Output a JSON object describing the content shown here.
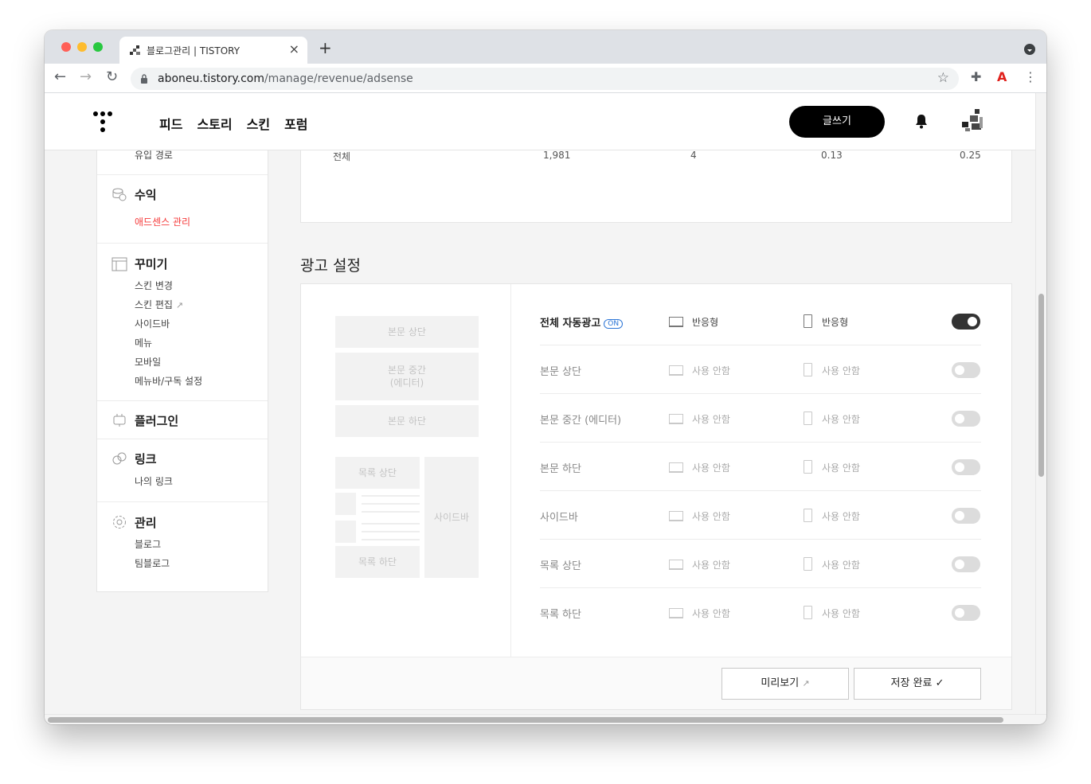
{
  "browser": {
    "tab_title": "블로그관리 | TISTORY",
    "tab_close": "×",
    "new_tab": "+",
    "url_domain": "aboneu.tistory.com",
    "url_path": "/manage/revenue/adsense"
  },
  "header": {
    "nav": [
      "피드",
      "스토리",
      "스킨",
      "포럼"
    ],
    "write_label": "글쓰기"
  },
  "sidebar": {
    "inflow_item": "유입 경로",
    "revenue": {
      "title": "수익",
      "items": [
        "애드센스 관리"
      ]
    },
    "decorate": {
      "title": "꾸미기",
      "items": [
        "스킨 변경",
        "스킨 편집",
        "사이드바",
        "메뉴",
        "모바일",
        "메뉴바/구독 설정"
      ]
    },
    "plugin": {
      "title": "플러그인"
    },
    "link": {
      "title": "링크",
      "items": [
        "나의 링크"
      ]
    },
    "manage": {
      "title": "관리",
      "items": [
        "블로그",
        "팀블로그"
      ]
    }
  },
  "stats_total": {
    "label": "전체",
    "values": [
      "1,981",
      "4",
      "0.13",
      "0.25"
    ]
  },
  "ad_settings": {
    "title": "광고 설정",
    "preview": {
      "body_top": "본문 상단",
      "body_middle_line1": "본문 중간",
      "body_middle_line2": "(에디터)",
      "body_bottom": "본문 하단",
      "list_top": "목록 상단",
      "list_bottom": "목록 하단",
      "sidebar": "사이드바"
    },
    "rows": [
      {
        "label": "전체 자동광고",
        "badge": "ON",
        "pc": "반응형",
        "mobile": "반응형",
        "enabled": true
      },
      {
        "label": "본문 상단",
        "pc": "사용 안함",
        "mobile": "사용 안함",
        "enabled": false
      },
      {
        "label": "본문 중간 (에디터)",
        "pc": "사용 안함",
        "mobile": "사용 안함",
        "enabled": false
      },
      {
        "label": "본문 하단",
        "pc": "사용 안함",
        "mobile": "사용 안함",
        "enabled": false
      },
      {
        "label": "사이드바",
        "pc": "사용 안함",
        "mobile": "사용 안함",
        "enabled": false
      },
      {
        "label": "목록 상단",
        "pc": "사용 안함",
        "mobile": "사용 안함",
        "enabled": false
      },
      {
        "label": "목록 하단",
        "pc": "사용 안함",
        "mobile": "사용 안함",
        "enabled": false
      }
    ],
    "preview_button": "미리보기",
    "save_button": "저장 완료"
  },
  "colors": {
    "accent_red": "#f53c3c",
    "badge_blue": "#2c75d6",
    "toggle_on": "#333333"
  }
}
